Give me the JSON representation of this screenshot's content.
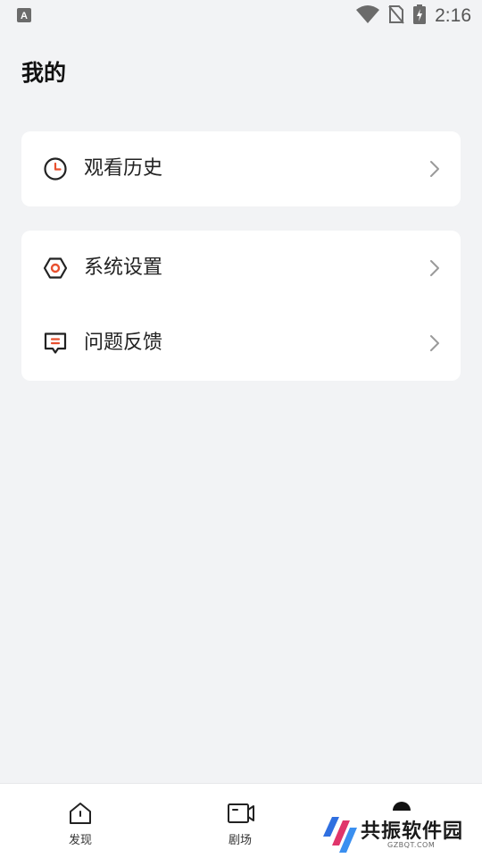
{
  "status_bar": {
    "time": "2:16",
    "left_icon": "text-a-notification-icon",
    "icons": [
      "wifi-icon",
      "no-sim-icon",
      "battery-charging-icon"
    ]
  },
  "page": {
    "title": "我的"
  },
  "menu": {
    "history": {
      "label": "观看历史",
      "icon": "clock-icon"
    },
    "settings": {
      "label": "系统设置",
      "icon": "hexagon-settings-icon"
    },
    "feedback": {
      "label": "问题反馈",
      "icon": "message-feedback-icon"
    }
  },
  "bottom_nav": {
    "items": [
      {
        "label": "发现",
        "icon": "home-icon"
      },
      {
        "label": "剧场",
        "icon": "video-camera-icon"
      },
      {
        "label": "",
        "icon": "profile-icon"
      }
    ]
  },
  "watermark": {
    "title": "共振软件园",
    "subtitle": "GZBQT.COM"
  },
  "colors": {
    "background": "#f2f3f5",
    "card": "#ffffff",
    "accent": "#e8502f",
    "text": "#222222"
  }
}
